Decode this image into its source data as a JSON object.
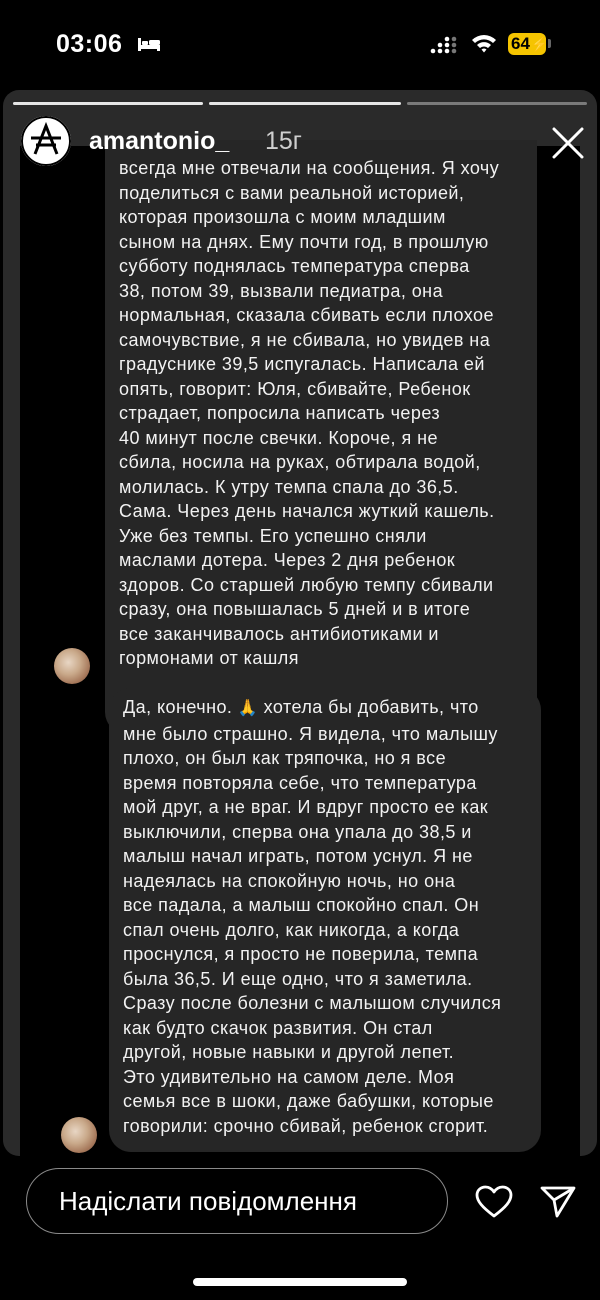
{
  "status_bar": {
    "time": "03:06",
    "battery_level": "64",
    "icons": [
      "bed-icon",
      "signal-icon",
      "wifi-icon",
      "battery-icon"
    ]
  },
  "story": {
    "username": "amantonio_",
    "time_ago": "15г",
    "progress_segments": 3,
    "active_segment": 3
  },
  "messages": [
    {
      "text": "всегда мне отвечали на сообщения. Я хочу\nподелиться с вами реальной историей,\nкоторая произошла с моим младшим\nсыном на днях. Ему почти год, в прошлую\nсубботу поднялась температура сперва\n38, потом 39, вызвали педиатра, она\nнормальная, сказала сбивать если плохое\nсамочувствие, я не сбивала, но увидев на\nградуснике 39,5 испугалась. Написала ей\nопять, говорит: Юля, сбивайте, Ребенок\nстрадает, попросила написать через\n40 минут после свечки. Короче, я не\nсбила, носила на руках, обтирала водой,\nмолилась. К утру темпа спала до 36,5.\nСама. Через день начался жуткий кашель.\nУже без темпы. Его успешно сняли\nмаслами дотера. Через 2 дня ребенок\nздоров. Со старшей любую темпу сбивали\nсразу, она повышалась 5 дней и в итоге\nвсе заканчивалось антибиотиками и\nгормонами от кашля"
    },
    {
      "text_before_emoji": "Да, конечно. ",
      "emoji": "🙏",
      "text_after_emoji": " хотела бы добавить, что\nмне было страшно. Я видела, что малышу\nплохо, он был как тряпочка, но я все\nвремя повторяла себе, что температура\nмой друг, а не враг. И вдруг просто ее как\nвыключили, сперва она упала до 38,5 и\nмалыш начал играть, потом уснул. Я не\nнадеялась на спокойную ночь, но она\nвсе падала, а малыш спокойно спал. Он\nспал очень долго, как никогда, а когда\nпроснулся, я просто не поверила, темпа\nбыла 36,5. И еще одно, что я заметила.\nСразу после болезни с малышом случился\nкак будто скачок развития. Он стал\nдругой, новые навыки и другой лепет.\nЭто удивительно на самом деле. Моя\nсемья все в шоки, даже бабушки, которые\nговорили: срочно сбивай, ребенок сгорит."
    }
  ],
  "bottom_bar": {
    "input_placeholder": "Надіслати повідомлення",
    "icons": [
      "heart-icon",
      "send-icon"
    ]
  },
  "colors": {
    "background": "#000000",
    "bubble": "#262626",
    "battery": "#f5c400",
    "text": "#ffffff"
  }
}
